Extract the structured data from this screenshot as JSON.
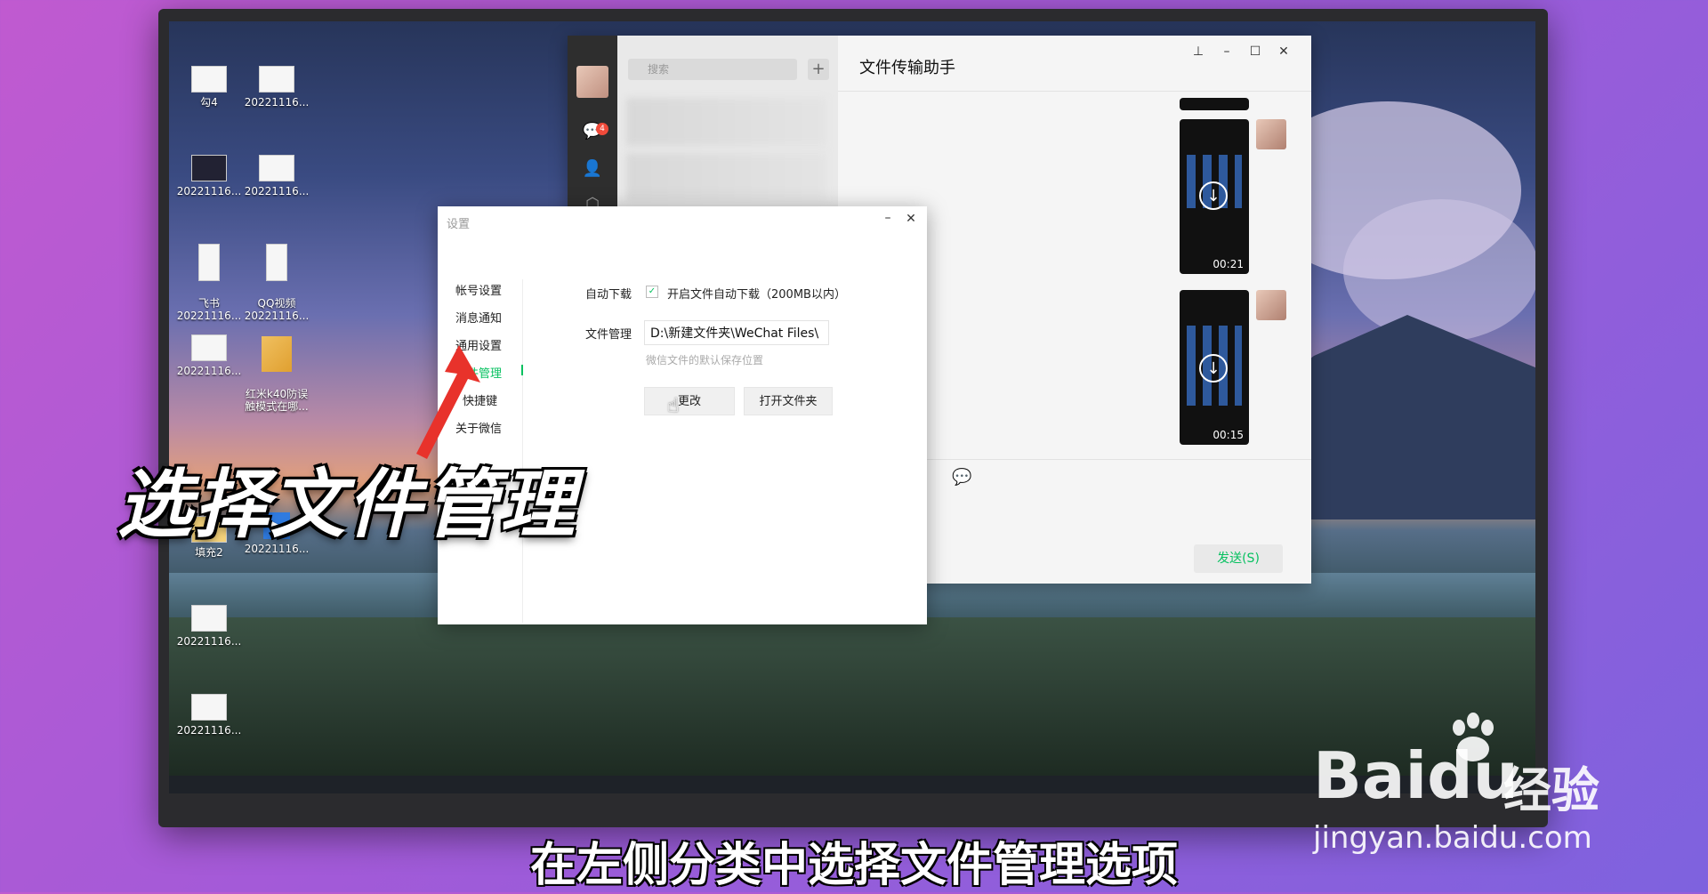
{
  "desktop": {
    "icons": [
      {
        "label": "勾4"
      },
      {
        "label": "20221116..."
      },
      {
        "label": "20221116..."
      },
      {
        "label": "20221116..."
      },
      {
        "label": "飞书\n20221116..."
      },
      {
        "label": "QQ视频\n20221116..."
      },
      {
        "label": "20221116..."
      },
      {
        "label": "红米k40防误\n触模式在哪..."
      },
      {
        "label": "填充2"
      },
      {
        "label": "20221116..."
      },
      {
        "label": "20221116..."
      },
      {
        "label": "20221116..."
      }
    ]
  },
  "wechat": {
    "search_placeholder": "搜索",
    "unread_badge": "4",
    "chat_title": "文件传输助手",
    "videos": [
      {
        "duration": "00:21"
      },
      {
        "duration": "00:15"
      }
    ],
    "send_label": "发送(S)"
  },
  "settings": {
    "title": "设置",
    "nav": [
      {
        "label": "帐号设置"
      },
      {
        "label": "消息通知"
      },
      {
        "label": "通用设置"
      },
      {
        "label": "文件管理"
      },
      {
        "label": "快捷键"
      },
      {
        "label": "关于微信"
      }
    ],
    "active_nav": "文件管理",
    "auto_download_label": "自动下载",
    "auto_download_option": "开启文件自动下载（200MB以内）",
    "auto_download_checked": true,
    "file_manage_label": "文件管理",
    "file_path": "D:\\新建文件夹\\WeChat Files\\",
    "file_path_hint": "微信文件的默认保存位置",
    "change_button": "更改",
    "open_folder_button": "打开文件夹"
  },
  "overlay": {
    "caption": "选择文件管理",
    "subtitle": "在左侧分类中选择文件管理选项",
    "accent_color": "#07c160",
    "arrow_color": "#e8322b"
  },
  "watermark": {
    "logo": "Baidu",
    "cn": "经验",
    "url": "jingyan.baidu.com"
  }
}
